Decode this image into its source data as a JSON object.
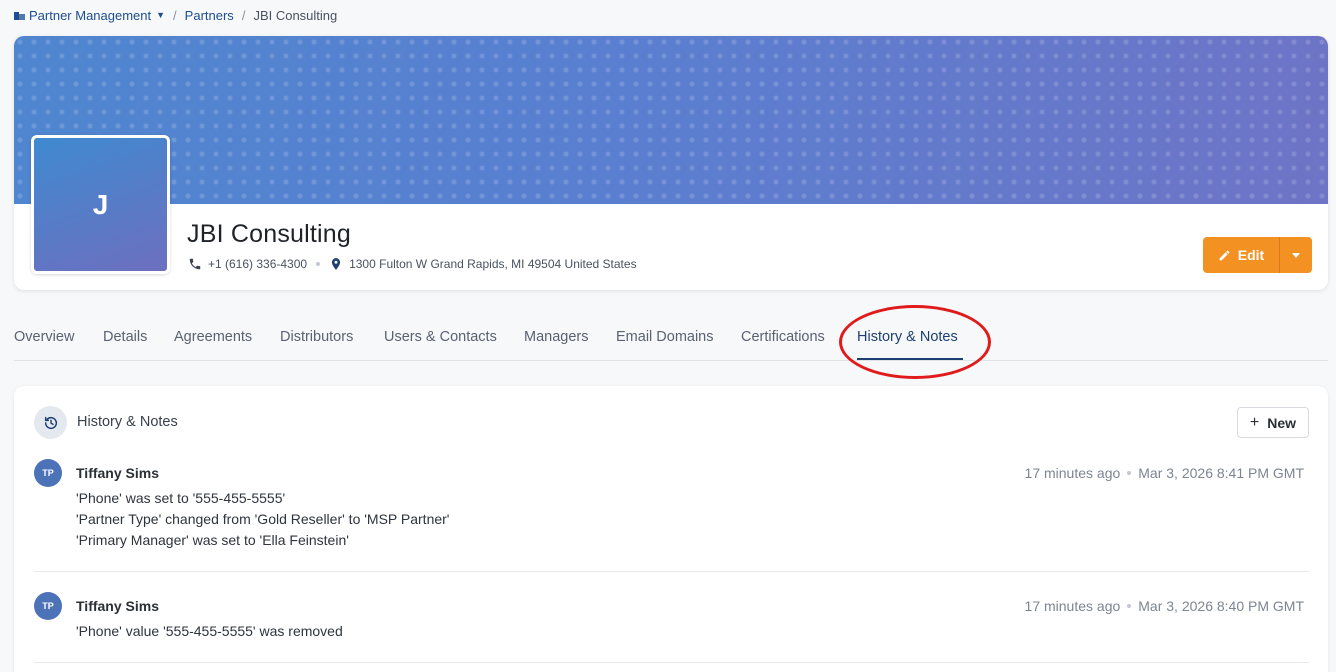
{
  "breadcrumb": {
    "root": "Partner Management",
    "partners": "Partners",
    "current": "JBI Consulting"
  },
  "company": {
    "initial": "J",
    "name": "JBI Consulting",
    "phone": "+1 (616) 336-4300",
    "address": "1300 Fulton W Grand Rapids, MI 49504 United States"
  },
  "actions": {
    "edit_label": "Edit"
  },
  "tabs": [
    {
      "label": "Overview"
    },
    {
      "label": "Details"
    },
    {
      "label": "Agreements"
    },
    {
      "label": "Distributors"
    },
    {
      "label": "Users & Contacts"
    },
    {
      "label": "Managers"
    },
    {
      "label": "Email Domains"
    },
    {
      "label": "Certifications"
    },
    {
      "label": "History & Notes",
      "active": true
    }
  ],
  "history": {
    "title": "History & Notes",
    "new_label": "New",
    "entries": [
      {
        "initials": "TP",
        "user": "Tiffany Sims",
        "relative_time": "17 minutes ago",
        "timestamp": "Mar 3, 2026 8:41 PM GMT",
        "lines": [
          "'Phone' was set to '555-455-5555'",
          "'Partner Type' changed from 'Gold Reseller' to 'MSP Partner'",
          "'Primary Manager' was set to 'Ella Feinstein'"
        ]
      },
      {
        "initials": "TP",
        "user": "Tiffany Sims",
        "relative_time": "17 minutes ago",
        "timestamp": "Mar 3, 2026 8:40 PM GMT",
        "lines": [
          "'Phone' value '555-455-5555' was removed"
        ]
      }
    ]
  },
  "colors": {
    "accent_orange": "#f39223",
    "link_blue": "#1d4e8f",
    "active_tab": "#1d3f72",
    "highlight_ring": "#e01b1b"
  }
}
